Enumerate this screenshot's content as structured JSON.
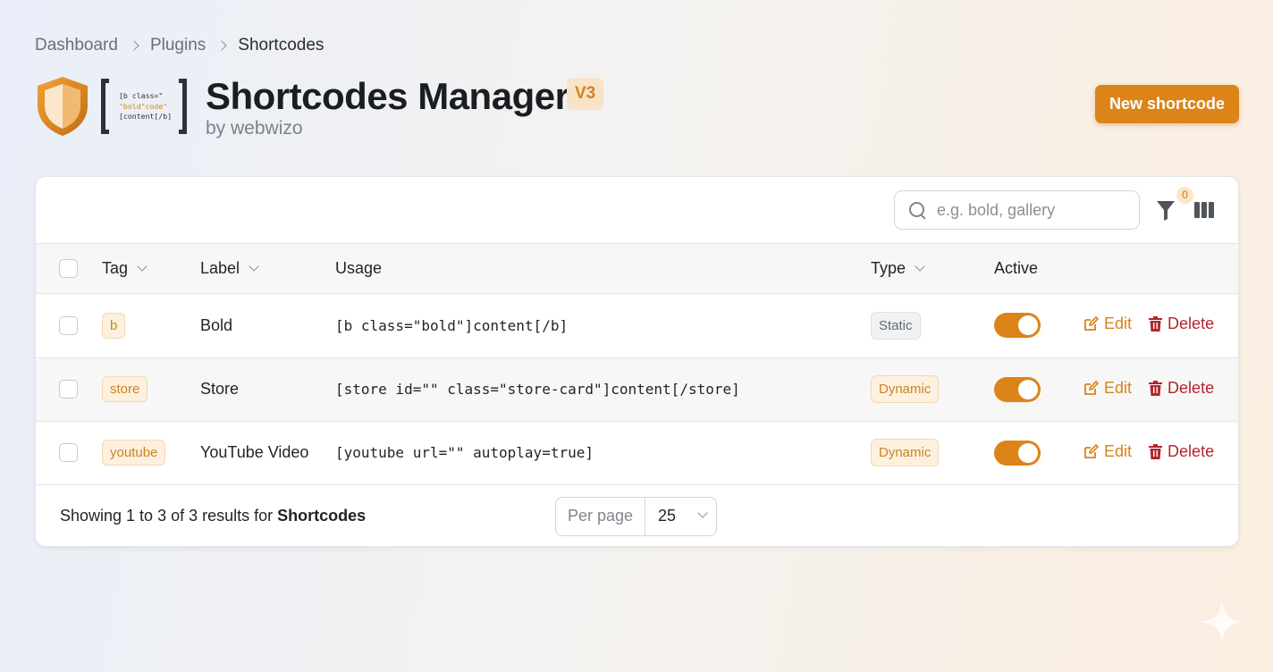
{
  "breadcrumb": {
    "items": [
      "Dashboard",
      "Plugins"
    ],
    "current": "Shortcodes"
  },
  "logo": {
    "code_lines": [
      "[b class=\"",
      "\"bold\"code\"",
      "[content[/b]"
    ]
  },
  "header": {
    "title": "Shortcodes Manager",
    "version": "V3",
    "byline": "by webwizo",
    "new_button": "New shortcode"
  },
  "toolbar": {
    "search_placeholder": "e.g. bold, gallery",
    "filter_count": "0"
  },
  "table": {
    "columns": {
      "tag": "Tag",
      "label": "Label",
      "usage": "Usage",
      "type": "Type",
      "active": "Active"
    },
    "rows": [
      {
        "tag": "b",
        "label": "Bold",
        "usage": "[b class=\"bold\"]content[/b]",
        "type": "Static",
        "active": true,
        "edit": "Edit",
        "delete": "Delete"
      },
      {
        "tag": "store",
        "label": "Store",
        "usage": "[store id=\"\" class=\"store-card\"]content[/store]",
        "type": "Dynamic",
        "active": true,
        "edit": "Edit",
        "delete": "Delete"
      },
      {
        "tag": "youtube",
        "label": "YouTube Video",
        "usage": "[youtube url=\"\" autoplay=true]",
        "type": "Dynamic",
        "active": true,
        "edit": "Edit",
        "delete": "Delete"
      }
    ]
  },
  "footer": {
    "showing_prefix": "Showing 1 to 3 of 3 results for",
    "showing_subject": "Shortcodes",
    "per_page_label": "Per page",
    "per_page_value": "25"
  },
  "colors": {
    "accent": "#dc8418",
    "danger": "#b4262c"
  }
}
